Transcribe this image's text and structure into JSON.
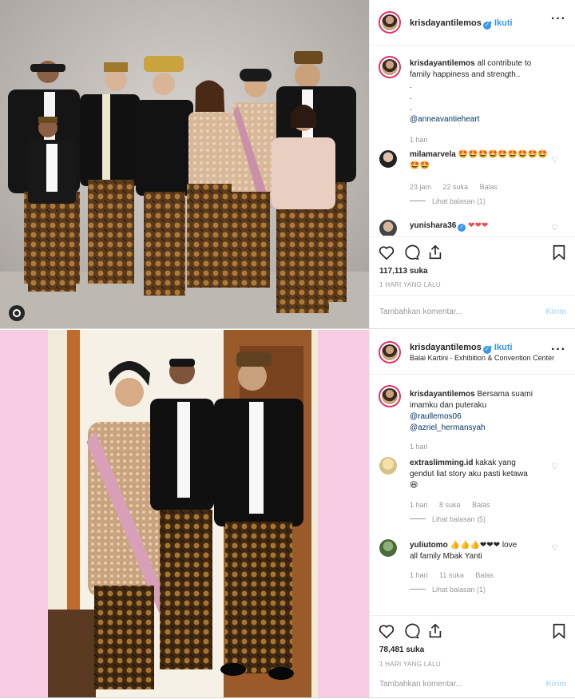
{
  "colors": {
    "accent": "#3897f0",
    "link": "#003569",
    "muted": "#999999",
    "pink_backdrop": "#f7cbe2",
    "heart": "#ed4956"
  },
  "post1": {
    "username": "krisdayantilemos",
    "follow": "Ikuti",
    "caption_user": "krisdayantilemos",
    "caption_line1": "all contribute to",
    "caption_line2": "family happiness and strength..",
    "caption_dots": [
      ".",
      ".",
      "."
    ],
    "caption_mention": "@anneavantieheart",
    "caption_time": "1 hari",
    "comments": [
      {
        "user": "milamarvela",
        "text": "🤩🤩🤩🤩🤩🤩🤩🤩🤩🤩🤩",
        "time": "23 jam",
        "likes": "22 suka",
        "reply": "Balas",
        "view_replies": "Lihat balasan (1)"
      },
      {
        "user": "yunishara36",
        "text": "❤❤❤"
      }
    ],
    "likes": "117,113 suka",
    "time_ago": "1 HARI YANG LALU",
    "add_comment_placeholder": "Tambahkan komentar...",
    "post_label": "Kirim"
  },
  "post2": {
    "username": "krisdayantilemos",
    "follow": "Ikuti",
    "location": "Balai Kartini - Exhibition & Convention Center",
    "caption_user": "krisdayantilemos",
    "caption_line1": "Bersama suami",
    "caption_line2": "imamku dan puteraku",
    "caption_mention1": "@raullemos06",
    "caption_mention2": "@azriel_hermansyah",
    "caption_time": "1 hari",
    "comments": [
      {
        "user": "extraslimming.id",
        "text_line1": "kakak yang",
        "text_line2": "gendut liat story aku pasti ketawa",
        "emoji": "😆",
        "time": "1 hari",
        "likes": "8 suka",
        "reply": "Balas",
        "view_replies": "Lihat balasan (5)"
      },
      {
        "user": "yuliutomo",
        "text_line1": "👍👍👍❤❤❤ love",
        "text_line2": "all family Mbak Yanti",
        "time": "1 hari",
        "likes": "11 suka",
        "reply": "Balas",
        "view_replies": "Lihat balasan (1)"
      }
    ],
    "likes": "78,481 suka",
    "time_ago": "1 HARI YANG LALU",
    "add_comment_placeholder": "Tambahkan komentar...",
    "post_label": "Kirim"
  },
  "icons": [
    "heart-icon",
    "comment-icon",
    "share-icon",
    "bookmark-icon",
    "more-options-icon",
    "verified-badge-icon",
    "carousel-icon"
  ]
}
